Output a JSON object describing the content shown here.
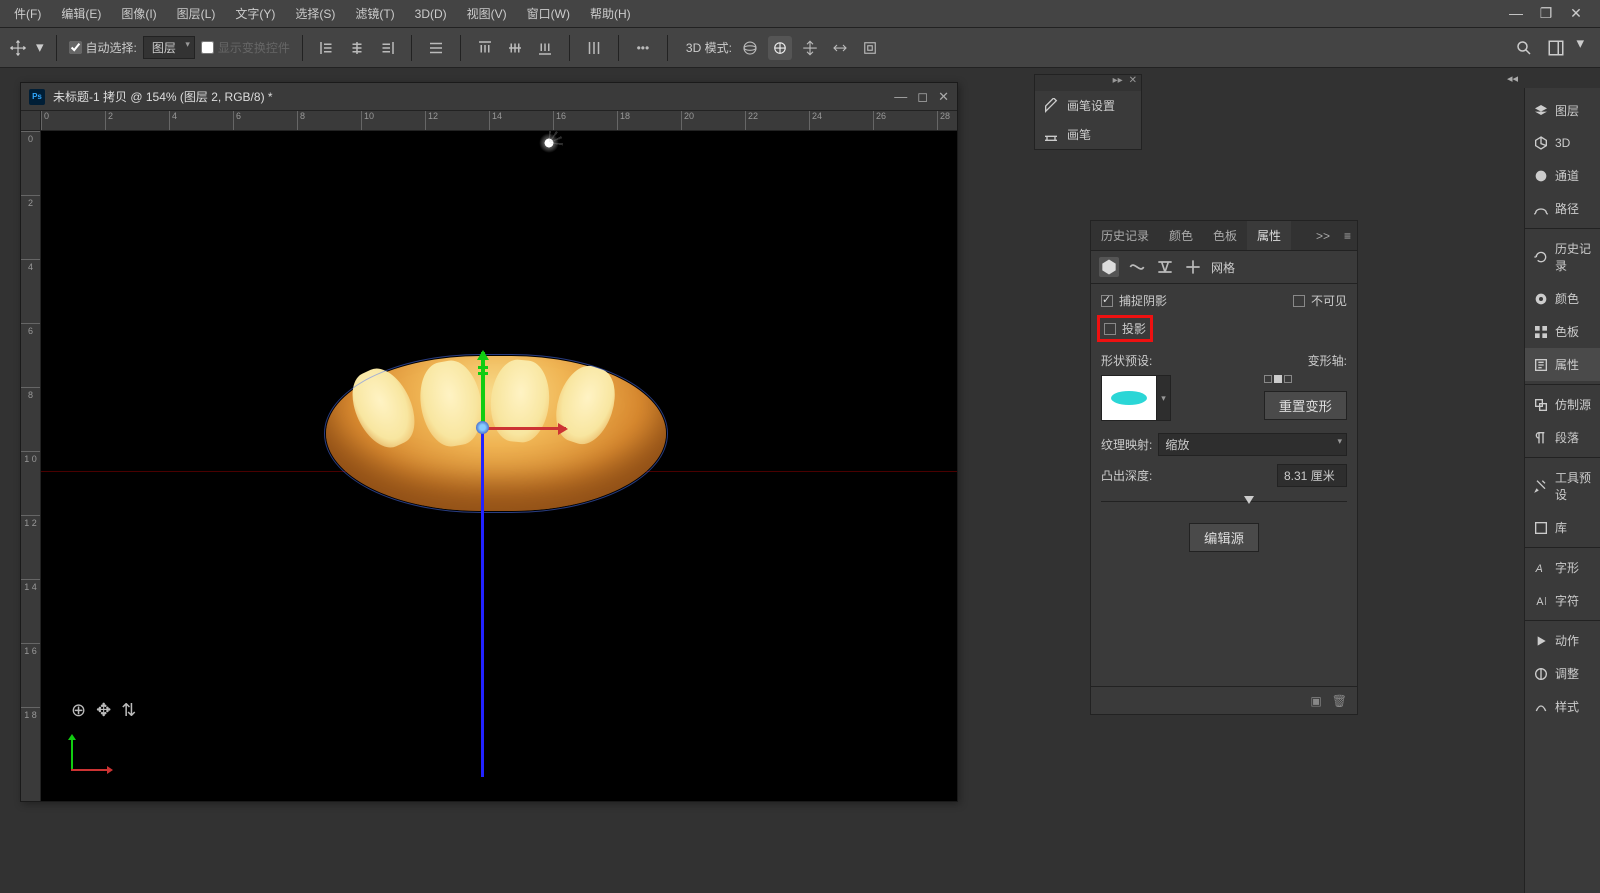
{
  "menu": {
    "file": "件(F)",
    "edit": "编辑(E)",
    "image": "图像(I)",
    "layer": "图层(L)",
    "type": "文字(Y)",
    "select": "选择(S)",
    "filter": "滤镜(T)",
    "3d": "3D(D)",
    "view": "视图(V)",
    "window": "窗口(W)",
    "help": "帮助(H)"
  },
  "windowControls": {
    "min": "—",
    "restore": "❐",
    "close": "✕"
  },
  "options": {
    "autoSelect": "自动选择:",
    "autoSelectTarget": "图层",
    "showTransform": "显示变换控件",
    "mode3dLabel": "3D 模式:",
    "more": "•••"
  },
  "doc": {
    "title": "未标题-1 拷贝 @ 154% (图层 2, RGB/8) *",
    "rulerH": [
      "0",
      "2",
      "4",
      "6",
      "8",
      "10",
      "12",
      "14",
      "16",
      "18",
      "20",
      "22",
      "24",
      "26",
      "28"
    ],
    "rulerV": [
      "0",
      "2",
      "4",
      "6",
      "8",
      "1\n0",
      "1\n2",
      "1\n4",
      "1\n6",
      "1\n8"
    ]
  },
  "brushPanel": {
    "brushSettings": "画笔设置",
    "brush": "画笔"
  },
  "propertiesPanel": {
    "tabs": {
      "history": "历史记录",
      "color": "颜色",
      "swatches": "色板",
      "properties": "属性"
    },
    "more": ">>",
    "meshLabel": "网格",
    "captureShadow": "捕捉阴影",
    "invisible": "不可见",
    "castShadow": "投影",
    "shapePreset": "形状预设:",
    "deformAxis": "变形轴:",
    "resetDeform": "重置变形",
    "textureMapping": "纹理映射:",
    "textureMappingValue": "缩放",
    "extrudeDepth": "凸出深度:",
    "extrudeDepthValue": "8.31 厘米",
    "editSource": "编辑源"
  },
  "rightStrip": {
    "layers": "图层",
    "3d": "3D",
    "channels": "通道",
    "paths": "路径",
    "history": "历史记录",
    "color": "颜色",
    "swatches": "色板",
    "properties": "属性",
    "clone": "仿制源",
    "paragraph": "段落",
    "toolPresets": "工具预设",
    "libraries": "库",
    "glyphs": "字形",
    "character": "字符",
    "actions": "动作",
    "adjustments": "调整",
    "styles": "样式"
  }
}
